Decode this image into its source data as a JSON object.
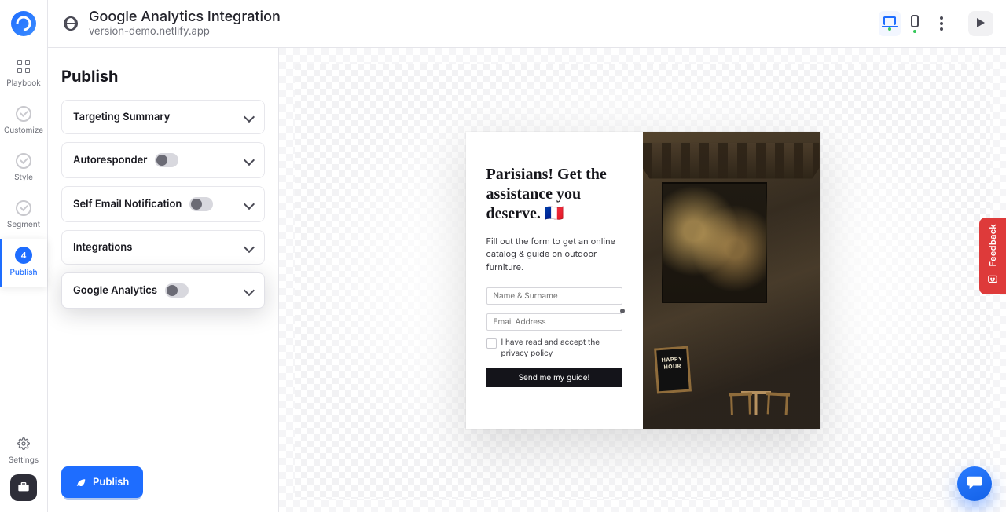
{
  "header": {
    "title": "Google Analytics Integration",
    "subtitle": "version-demo.netlify.app"
  },
  "rail": {
    "items": [
      {
        "key": "playbook",
        "label": "Playbook"
      },
      {
        "key": "customize",
        "label": "Customize"
      },
      {
        "key": "style",
        "label": "Style"
      },
      {
        "key": "segment",
        "label": "Segment"
      },
      {
        "key": "publish",
        "label": "Publish",
        "badge": "4",
        "active": true
      }
    ],
    "settings_label": "Settings"
  },
  "panel": {
    "heading": "Publish",
    "items": [
      {
        "key": "targeting",
        "label": "Targeting Summary",
        "has_toggle": false
      },
      {
        "key": "autoresponder",
        "label": "Autoresponder",
        "has_toggle": true,
        "toggle_on": false
      },
      {
        "key": "self_email",
        "label": "Self Email Notification",
        "has_toggle": true,
        "toggle_on": false
      },
      {
        "key": "integrations",
        "label": "Integrations",
        "has_toggle": false
      },
      {
        "key": "google_analytics",
        "label": "Google Analytics",
        "has_toggle": true,
        "toggle_on": false,
        "highlight": true
      }
    ],
    "publish_button": "Publish"
  },
  "preview": {
    "headline": "Parisians! Get the assistance you deserve. 🇫🇷",
    "subtext": "Fill out the form to get an online catalog & guide on outdoor furniture.",
    "name_placeholder": "Name & Surname",
    "email_placeholder": "Email Address",
    "consent_prefix": "I have read and accept the ",
    "consent_link": "privacy policy",
    "cta": "Send me my guide!",
    "chalkboard_l1": "HAPPY",
    "chalkboard_l2": "HOUR"
  },
  "feedback": {
    "label": "Feedback"
  }
}
